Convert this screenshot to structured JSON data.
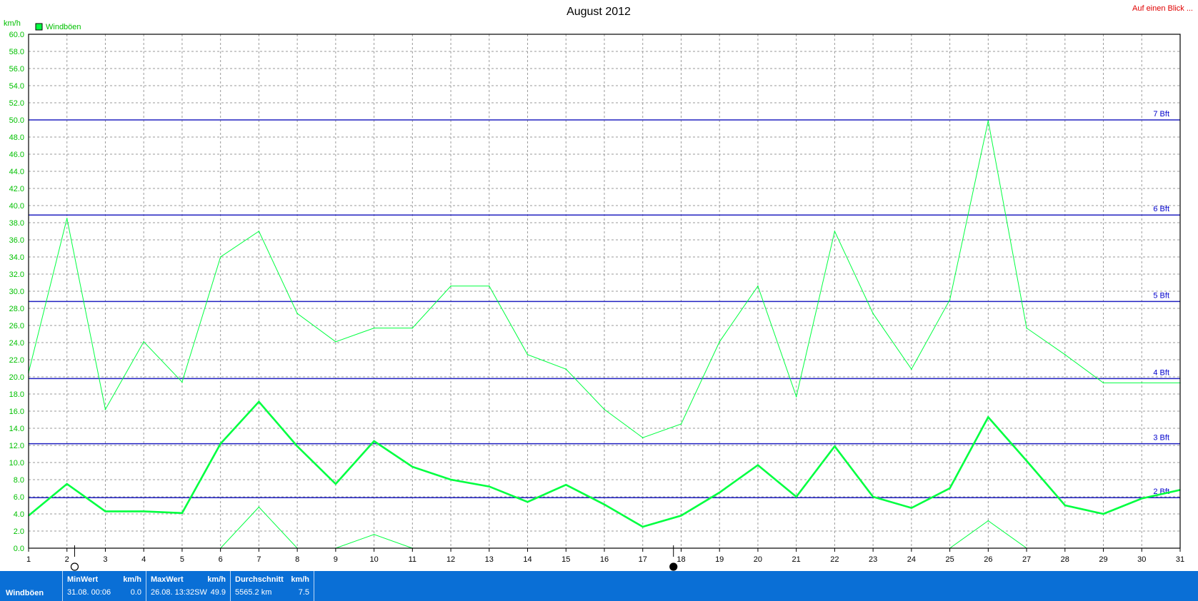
{
  "header": {
    "title": "August 2012",
    "unit": "km/h",
    "legend_label": "Windböen",
    "legend_color": "#00ff40",
    "link_text": "Auf einen Blick ..."
  },
  "chart_data": {
    "type": "line",
    "title": "August 2012",
    "ylabel": "km/h",
    "xlabel": "",
    "ylim": [
      0,
      60
    ],
    "y_ticks": [
      "0.0",
      "2.0",
      "4.0",
      "6.0",
      "8.0",
      "10.0",
      "12.0",
      "14.0",
      "16.0",
      "18.0",
      "20.0",
      "22.0",
      "24.0",
      "26.0",
      "28.0",
      "30.0",
      "32.0",
      "34.0",
      "36.0",
      "38.0",
      "40.0",
      "42.0",
      "44.0",
      "46.0",
      "48.0",
      "50.0",
      "52.0",
      "54.0",
      "56.0",
      "58.0",
      "60.0"
    ],
    "x": [
      1,
      2,
      3,
      4,
      5,
      6,
      7,
      8,
      9,
      10,
      11,
      12,
      13,
      14,
      15,
      16,
      17,
      18,
      19,
      20,
      21,
      22,
      23,
      24,
      25,
      26,
      27,
      28,
      29,
      30,
      31
    ],
    "x_ticks": [
      "1",
      "2",
      "3",
      "4",
      "5",
      "6",
      "7",
      "8",
      "9",
      "10",
      "11",
      "12",
      "13",
      "14",
      "15",
      "16",
      "17",
      "18",
      "19",
      "20",
      "21",
      "22",
      "23",
      "24",
      "25",
      "26",
      "27",
      "28",
      "29",
      "30",
      "31"
    ],
    "grid": true,
    "legend_position": "top-left",
    "series": [
      {
        "name": "Windböen",
        "color": "#00ff40",
        "style": "thin-max",
        "values": [
          20.5,
          38.5,
          16.2,
          24.1,
          19.4,
          34,
          37,
          27.4,
          24.1,
          25.7,
          25.7,
          30.6,
          30.6,
          22.6,
          20.9,
          16.2,
          12.9,
          14.5,
          24.1,
          30.6,
          17.7,
          37,
          27.4,
          20.9,
          29,
          49.9,
          25.7,
          22.6,
          19.3,
          19.3,
          19.3
        ]
      },
      {
        "name": "",
        "color": "#00ff40",
        "style": "thick-avg",
        "values": [
          3.8,
          7.5,
          4.3,
          4.3,
          4.1,
          12.2,
          17.1,
          11.9,
          7.5,
          12.5,
          9.5,
          8,
          7.2,
          5.4,
          7.4,
          5.1,
          2.5,
          3.8,
          6.5,
          9.7,
          6,
          11.9,
          6,
          4.7,
          7,
          15.3,
          10.2,
          5,
          4,
          5.8,
          6.8
        ]
      },
      {
        "name": "",
        "color": "#00ff40",
        "style": "thin-min",
        "values": [
          null,
          null,
          null,
          null,
          null,
          0,
          4.8,
          0,
          0,
          1.6,
          0,
          null,
          null,
          null,
          null,
          null,
          null,
          null,
          null,
          null,
          null,
          null,
          null,
          null,
          0,
          3.2,
          0,
          null,
          null,
          null,
          null
        ]
      }
    ],
    "reference_lines": [
      {
        "label": "2 Bft",
        "value": 5.9
      },
      {
        "label": "3 Bft",
        "value": 12.2
      },
      {
        "label": "4 Bft",
        "value": 19.8
      },
      {
        "label": "5 Bft",
        "value": 28.8
      },
      {
        "label": "6 Bft",
        "value": 38.9
      },
      {
        "label": "7 Bft",
        "value": 50
      }
    ],
    "moon_markers": [
      {
        "day": 2.2,
        "phase": "full"
      },
      {
        "day": 17.8,
        "phase": "new"
      }
    ]
  },
  "footer": {
    "series_name": "Windböen",
    "min": {
      "header": "MinWert",
      "unit": "km/h",
      "date_time": "31.08.  00:06",
      "value": "0.0"
    },
    "max": {
      "header": "MaxWert",
      "unit": "km/h",
      "date_time": "26.08.  13:32SW",
      "value": "49.9"
    },
    "avg": {
      "header": "Durchschnitt",
      "unit": "km/h",
      "distance": "5565.2 km",
      "value": "7.5"
    }
  }
}
